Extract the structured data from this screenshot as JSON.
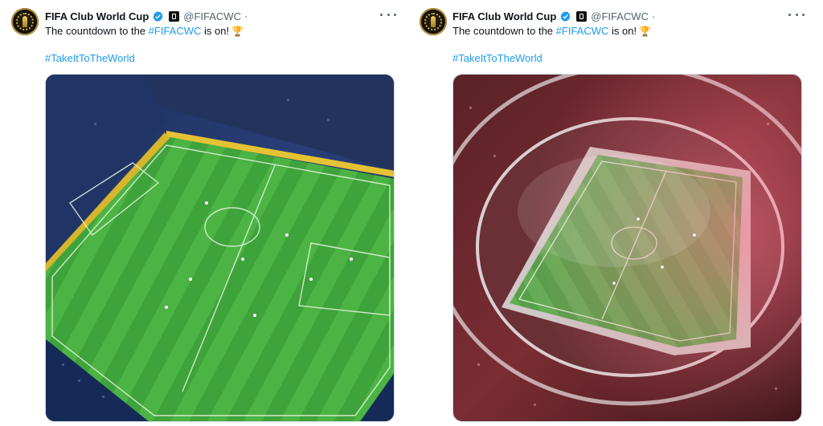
{
  "tweets": [
    {
      "account_name": "FIFA Club World Cup",
      "handle": "@FIFACWC",
      "separator": "·",
      "text_before": "The countdown to the ",
      "text_link": "#FIFACWC",
      "text_after": " is on!",
      "trophy_emoji": "🏆",
      "hashtag": "#TakeItToTheWorld",
      "media_icon": "stadium-aerial-blue-yellow",
      "more_icon": "more-options-icon"
    },
    {
      "account_name": "FIFA Club World Cup",
      "handle": "@FIFACWC",
      "separator": "·",
      "text_before": "The countdown to the ",
      "text_link": "#FIFACWC",
      "text_after": " is on!",
      "trophy_emoji": "🏆",
      "hashtag": "#TakeItToTheWorld",
      "media_icon": "stadium-aerial-red-white",
      "more_icon": "more-options-icon"
    }
  ],
  "colors": {
    "link": "#1d9bf0",
    "verified": "#1d9bf0",
    "secondary_text": "#536471"
  }
}
